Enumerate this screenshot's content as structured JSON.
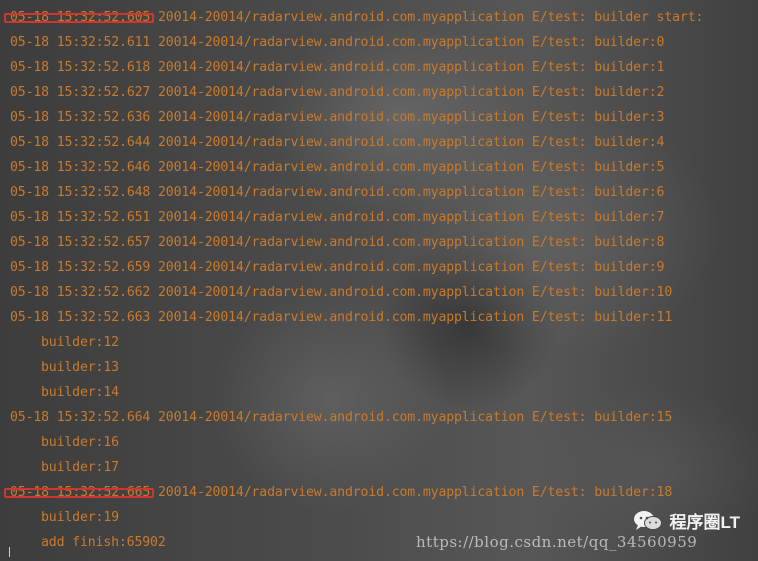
{
  "log_lines": [
    {
      "ts": "05-18 15:32:52.605",
      "msg": "20014-20014/radarview.android.com.myapplication E/test: builder start:",
      "highlighted": true
    },
    {
      "ts": "05-18 15:32:52.611",
      "msg": "20014-20014/radarview.android.com.myapplication E/test: builder:0"
    },
    {
      "ts": "05-18 15:32:52.618",
      "msg": "20014-20014/radarview.android.com.myapplication E/test: builder:1"
    },
    {
      "ts": "05-18 15:32:52.627",
      "msg": "20014-20014/radarview.android.com.myapplication E/test: builder:2"
    },
    {
      "ts": "05-18 15:32:52.636",
      "msg": "20014-20014/radarview.android.com.myapplication E/test: builder:3"
    },
    {
      "ts": "05-18 15:32:52.644",
      "msg": "20014-20014/radarview.android.com.myapplication E/test: builder:4"
    },
    {
      "ts": "05-18 15:32:52.646",
      "msg": "20014-20014/radarview.android.com.myapplication E/test: builder:5"
    },
    {
      "ts": "05-18 15:32:52.648",
      "msg": "20014-20014/radarview.android.com.myapplication E/test: builder:6"
    },
    {
      "ts": "05-18 15:32:52.651",
      "msg": "20014-20014/radarview.android.com.myapplication E/test: builder:7"
    },
    {
      "ts": "05-18 15:32:52.657",
      "msg": "20014-20014/radarview.android.com.myapplication E/test: builder:8"
    },
    {
      "ts": "05-18 15:32:52.659",
      "msg": "20014-20014/radarview.android.com.myapplication E/test: builder:9"
    },
    {
      "ts": "05-18 15:32:52.662",
      "msg": "20014-20014/radarview.android.com.myapplication E/test: builder:10"
    },
    {
      "ts": "05-18 15:32:52.663",
      "msg": "20014-20014/radarview.android.com.myapplication E/test: builder:11"
    },
    {
      "msg": "builder:12"
    },
    {
      "msg": "builder:13"
    },
    {
      "msg": "builder:14"
    },
    {
      "ts": "05-18 15:32:52.664",
      "msg": "20014-20014/radarview.android.com.myapplication E/test: builder:15"
    },
    {
      "msg": "builder:16"
    },
    {
      "msg": "builder:17"
    },
    {
      "ts": "05-18 15:32:52.665",
      "msg": "20014-20014/radarview.android.com.myapplication E/test: builder:18",
      "highlighted": true
    },
    {
      "msg": "builder:19"
    },
    {
      "msg": "add finish:65902"
    }
  ],
  "watermark": "https://blog.csdn.net/qq_34560959",
  "brand": {
    "name": "程序圈LT",
    "icon": "wechat-icon"
  },
  "colors": {
    "log_text": "#c97a2c",
    "highlight_box": "#d2342f"
  }
}
